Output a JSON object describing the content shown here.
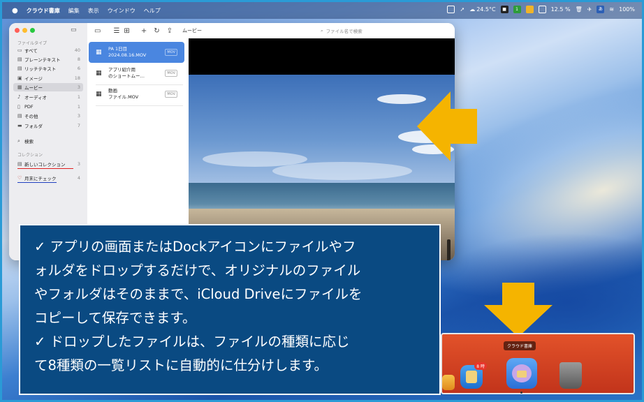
{
  "menubar": {
    "apple": "",
    "app_name": "クラウド書庫",
    "items": [
      "編集",
      "表示",
      "ウインドウ",
      "ヘルプ"
    ],
    "status": {
      "temperature": "24.5°C",
      "battery_percent": "12.5 %",
      "wifi_percent": "100%",
      "input_method": "あ",
      "badge_1": "1"
    }
  },
  "window": {
    "toolbar": {
      "title": "ムービー",
      "search_placeholder": "ファイル名で検索"
    },
    "sidebar": {
      "filetype_header": "ファイルタイプ",
      "items": [
        {
          "label": "すべて",
          "count": "40",
          "icon": "tray-icon"
        },
        {
          "label": "プレーンテキスト",
          "count": "8",
          "icon": "doc-icon"
        },
        {
          "label": "リッチテキスト",
          "count": "6",
          "icon": "doc-rich-icon"
        },
        {
          "label": "イメージ",
          "count": "18",
          "icon": "photo-icon"
        },
        {
          "label": "ムービー",
          "count": "3",
          "icon": "film-icon"
        },
        {
          "label": "オーディオ",
          "count": "1",
          "icon": "music-note-icon"
        },
        {
          "label": "PDF",
          "count": "1",
          "icon": "pdf-icon"
        },
        {
          "label": "その他",
          "count": "3",
          "icon": "other-icon"
        },
        {
          "label": "フォルダ",
          "count": "7",
          "icon": "folder-icon"
        }
      ],
      "search_label": "検索",
      "collection_header": "コレクション",
      "collections": [
        {
          "label": "新しいコレクション",
          "count": "3",
          "icon": "collection-icon"
        },
        {
          "label": "月末にチェック",
          "count": "4",
          "icon": "heart-icon"
        }
      ]
    },
    "files": [
      {
        "name_line1": "PA 1日目",
        "name_line2": "2024.08.16.MOV",
        "badge": "MOV"
      },
      {
        "name_line1": "アプリ紹介用",
        "name_line2": "のショートムー…",
        "badge": "MOV"
      },
      {
        "name_line1": "動画",
        "name_line2": "ファイル.MOV",
        "badge": "MOV"
      }
    ]
  },
  "callout": {
    "lines": [
      "✓ アプリの画面またはDockアイコンにファイルやフ",
      "ォルダをドロップするだけで、オリジナルのファイル",
      "やフォルダはそのままで、iCloud Driveにファイルを",
      "コピーして保存できます。",
      "✓ ドロップしたファイルは、ファイルの種類に応じ",
      "て8種類の一覧リストに自動的に仕分けします。"
    ]
  },
  "dock": {
    "tooltip": "クラウド書庫",
    "badge_text": "8 時"
  },
  "colors": {
    "accent": "#4a86e0",
    "callout_bg": "#0a4a82",
    "arrow": "#f5b400",
    "dock_bg": "#d9441f"
  }
}
